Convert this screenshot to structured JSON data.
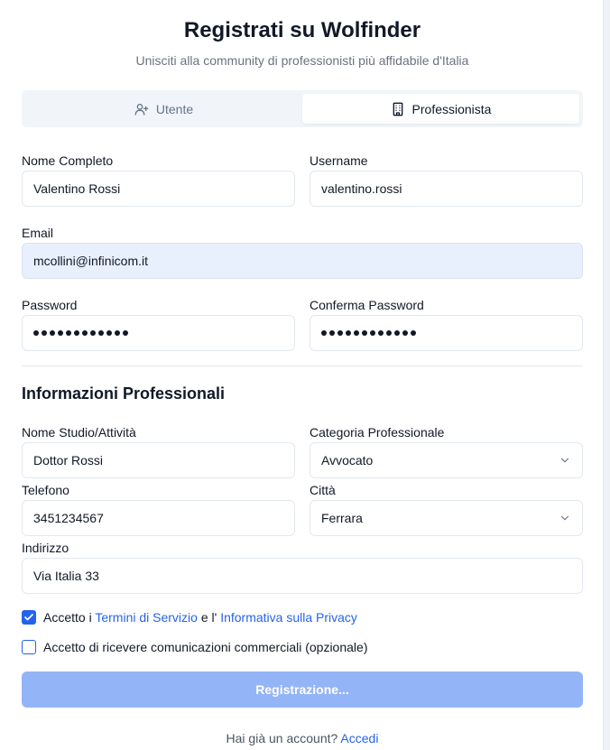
{
  "header": {
    "title": "Registrati su Wolfinder",
    "subtitle": "Unisciti alla community di professionisti più affidabile d'Italia"
  },
  "tabs": [
    {
      "label": "Utente",
      "icon": "user-plus-icon",
      "active": false
    },
    {
      "label": "Professionista",
      "icon": "building-icon",
      "active": true
    }
  ],
  "form": {
    "full_name": {
      "label": "Nome Completo",
      "value": "Valentino Rossi"
    },
    "username": {
      "label": "Username",
      "value": "valentino.rossi"
    },
    "email": {
      "label": "Email",
      "value": "mcollini@infinicom.it"
    },
    "password": {
      "label": "Password",
      "masked_length": 12
    },
    "confirm_password": {
      "label": "Conferma Password",
      "masked_length": 12
    }
  },
  "professional": {
    "section_title": "Informazioni Professionali",
    "studio": {
      "label": "Nome Studio/Attività",
      "value": "Dottor Rossi"
    },
    "category": {
      "label": "Categoria Professionale",
      "value": "Avvocato"
    },
    "phone": {
      "label": "Telefono",
      "value": "3451234567"
    },
    "city": {
      "label": "Città",
      "value": "Ferrara"
    },
    "address": {
      "label": "Indirizzo",
      "value": "Via Italia 33"
    }
  },
  "consents": {
    "terms": {
      "checked": true,
      "prefix": "Accetto i",
      "terms_link": "Termini di Servizio",
      "middle": "e l'",
      "privacy_link": "Informativa sulla Privacy"
    },
    "marketing": {
      "checked": false,
      "label": "Accetto di ricevere comunicazioni commerciali (opzionale)"
    }
  },
  "submit": {
    "label": "Registrazione..."
  },
  "footer": {
    "text": "Hai già un account?",
    "link": "Accedi"
  },
  "colors": {
    "accent": "#2563eb",
    "submit_disabled": "#93b4f7",
    "autofill_bg": "#e8f0fe"
  }
}
